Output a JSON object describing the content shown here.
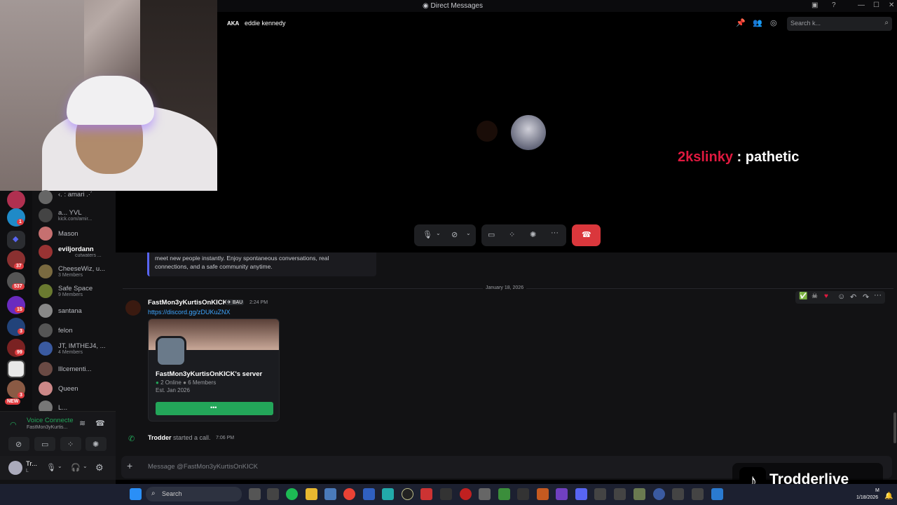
{
  "window": {
    "title": "Direct Messages"
  },
  "call": {
    "aka": "AKA",
    "name": "eddie kennedy",
    "search_placeholder": "Search k...",
    "overlay_user": "2kslinky",
    "overlay_sep": " : ",
    "overlay_text": "pathetic"
  },
  "servers": {
    "badges": [
      "1",
      "37",
      "537",
      "15",
      "3",
      "99",
      "3",
      "NEW"
    ]
  },
  "dms": [
    {
      "name": "‹. : amari .·´",
      "sub": ""
    },
    {
      "name": "a... YVL",
      "sub": "kick.com/amir..."
    },
    {
      "name": "Mason",
      "sub": ""
    },
    {
      "name": "eviljordann",
      "sub": "cutwaters ..."
    },
    {
      "name": "CheeseWiz, u...",
      "sub": "3 Members"
    },
    {
      "name": "Safe Space",
      "sub": "9 Members"
    },
    {
      "name": "santana",
      "sub": ""
    },
    {
      "name": "felon",
      "sub": ""
    },
    {
      "name": "JT, IMTHEJ4, ...",
      "sub": "4 Members"
    },
    {
      "name": "lllcementi...",
      "sub": ""
    },
    {
      "name": "Queen",
      "sub": ""
    },
    {
      "name": "L...",
      "sub": ""
    }
  ],
  "voice": {
    "status": "Voice Connecte",
    "channel": "FastMon3yKurtis..."
  },
  "user": {
    "name": "Tr...",
    "sub": "L"
  },
  "chat": {
    "prev_embed_text": "meet new people instantly. Enjoy spontaneous conversations, real connections, and a safe community anytime.",
    "date_divider": "January 18, 2026",
    "msg_author": "FastMon3yKurtisOnKICK",
    "msg_tag": "BAU",
    "msg_time": "2:24 PM",
    "msg_link": "https://discord.gg/zDUKuZNX",
    "invite_server": "FastMon3yKurtisOnKICK's server",
    "invite_online": "2 Online",
    "invite_members": "6 Members",
    "invite_est": "Est. Jan 2026",
    "call_author": "Trodder",
    "call_text": "started a call.",
    "call_time": "7:06 PM",
    "input_placeholder": "Message @FastMon3yKurtisOnKICK"
  },
  "watermark": "Trodderlive",
  "taskbar": {
    "search": "Search",
    "time": "M",
    "date": "1/18/2026"
  },
  "colors": {
    "accent": "#5865f2",
    "danger": "#da373c",
    "green": "#23a559",
    "overlay_red": "#e0193f"
  }
}
